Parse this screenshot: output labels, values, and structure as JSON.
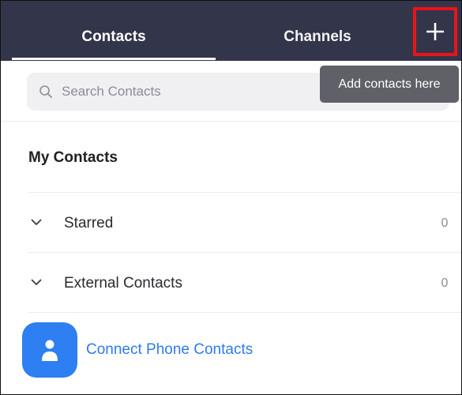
{
  "header": {
    "tabs": [
      {
        "label": "Contacts",
        "active": true
      },
      {
        "label": "Channels",
        "active": false
      }
    ],
    "add_icon": "plus-icon"
  },
  "tooltip": {
    "text": "Add contacts here"
  },
  "search": {
    "placeholder": "Search Contacts",
    "value": "",
    "icon": "search-icon"
  },
  "contacts": {
    "section_title": "My Contacts",
    "groups": [
      {
        "label": "Starred",
        "count": "0",
        "icon": "chevron-down-icon"
      },
      {
        "label": "External Contacts",
        "count": "0",
        "icon": "chevron-down-icon"
      }
    ],
    "connect": {
      "label": "Connect Phone Contacts",
      "icon": "person-icon"
    }
  },
  "colors": {
    "header_bg": "#33354a",
    "highlight": "#e8141a",
    "accent": "#2d7ff2",
    "tooltip_bg": "#5f6068"
  }
}
